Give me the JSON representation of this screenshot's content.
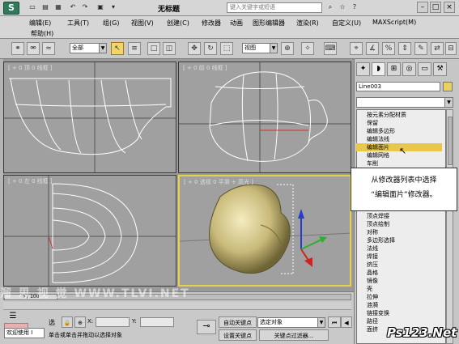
{
  "titlebar": {
    "logo": "S",
    "title": "无标题",
    "search_placeholder": "键入关键字或短语"
  },
  "menu": {
    "items": [
      "编辑(E)",
      "工具(T)",
      "组(G)",
      "视图(V)",
      "创建(C)",
      "修改器",
      "动画",
      "图形编辑器",
      "渲染(R)",
      "自定义(U)",
      "MAXScript(M)",
      "帮助(H)"
    ]
  },
  "toolbar": {
    "selection_filter": "全部",
    "ref_coord": "视图"
  },
  "viewports": {
    "top": "[ + 0 顶 0 线框 ]",
    "front": "[ + 0 前 0 线框 ]",
    "left": "[ + 0 左 0 线框 ]",
    "persp": "[ + 0 透视 0 平滑 + 高光 ]"
  },
  "panel": {
    "object_name": "Line003",
    "modifier_list": [
      "按元素分配材质",
      "保留",
      "编辑多边形",
      "编辑法线",
      "编辑面片",
      "编辑网格",
      "车削",
      "顶点焊接",
      "顶点绘制",
      "对称",
      "多边形选择",
      "法线",
      "焊接",
      "挤压",
      "晶格",
      "镜像",
      "壳",
      "拉伸",
      "涟漪",
      "链接变换",
      "路径",
      "面挤"
    ],
    "selected_modifier": "编辑面片"
  },
  "tooltip": {
    "line1": "从修改器列表中选择",
    "line2": "“编辑面片”修改器。"
  },
  "bottom": {
    "time_slider": "0 / 100",
    "welcome": "欢迎使用 I",
    "select_label": "选",
    "status": "单击或单击并拖动以选择对象",
    "x_label": "X:",
    "y_label": "Y:",
    "auto_key": "自动关键点",
    "set_key": "设置关键点",
    "selected_object": "选定对象",
    "key_filters": "关键点过滤器..."
  },
  "watermarks": {
    "left": "溜 思 视 觉   WWW.TLVI.NET",
    "right": "Ps123.Net"
  }
}
